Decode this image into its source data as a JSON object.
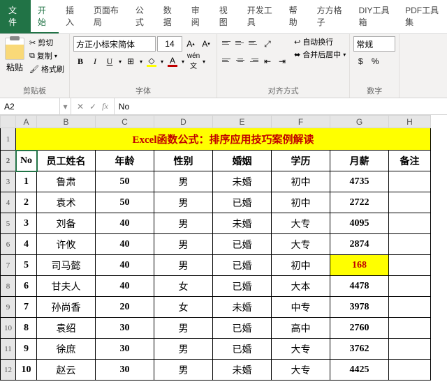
{
  "tabs": {
    "file": "文件",
    "items": [
      "开始",
      "插入",
      "页面布局",
      "公式",
      "数据",
      "审阅",
      "视图",
      "开发工具",
      "帮助",
      "方方格子",
      "DIY工具箱",
      "PDF工具集"
    ],
    "active": 0
  },
  "clipboard": {
    "paste": "粘贴",
    "cut": "剪切",
    "copy": "复制",
    "format": "格式刷",
    "group": "剪贴板"
  },
  "font": {
    "name": "方正小标宋简体",
    "size": "14",
    "group": "字体"
  },
  "align": {
    "wrap": "自动换行",
    "merge": "合并后居中",
    "group": "对齐方式"
  },
  "number": {
    "format": "常规",
    "group": "数字"
  },
  "namebox": "A2",
  "formula": "No",
  "cols": [
    "A",
    "B",
    "C",
    "D",
    "E",
    "F",
    "G",
    "H"
  ],
  "titleText": "Excel函数公式：排序应用技巧案例解读",
  "headers": [
    "No",
    "员工姓名",
    "年龄",
    "性别",
    "婚姻",
    "学历",
    "月薪",
    "备注"
  ],
  "rows": [
    {
      "n": "1",
      "name": "鲁肃",
      "age": "50",
      "sex": "男",
      "mar": "未婚",
      "edu": "初中",
      "sal": "4735"
    },
    {
      "n": "2",
      "name": "袁术",
      "age": "50",
      "sex": "男",
      "mar": "已婚",
      "edu": "初中",
      "sal": "2722"
    },
    {
      "n": "3",
      "name": "刘备",
      "age": "40",
      "sex": "男",
      "mar": "未婚",
      "edu": "大专",
      "sal": "4095"
    },
    {
      "n": "4",
      "name": "许攸",
      "age": "40",
      "sex": "男",
      "mar": "已婚",
      "edu": "大专",
      "sal": "2874"
    },
    {
      "n": "5",
      "name": "司马懿",
      "age": "40",
      "sex": "男",
      "mar": "已婚",
      "edu": "初中",
      "sal": "168",
      "hl": true
    },
    {
      "n": "6",
      "name": "甘夫人",
      "age": "40",
      "sex": "女",
      "mar": "已婚",
      "edu": "大本",
      "sal": "4478"
    },
    {
      "n": "7",
      "name": "孙尚香",
      "age": "20",
      "sex": "女",
      "mar": "未婚",
      "edu": "中专",
      "sal": "3978"
    },
    {
      "n": "8",
      "name": "袁绍",
      "age": "30",
      "sex": "男",
      "mar": "已婚",
      "edu": "高中",
      "sal": "2760"
    },
    {
      "n": "9",
      "name": "徐庶",
      "age": "30",
      "sex": "男",
      "mar": "已婚",
      "edu": "大专",
      "sal": "3762"
    },
    {
      "n": "10",
      "name": "赵云",
      "age": "30",
      "sex": "男",
      "mar": "未婚",
      "edu": "大专",
      "sal": "4425"
    }
  ]
}
